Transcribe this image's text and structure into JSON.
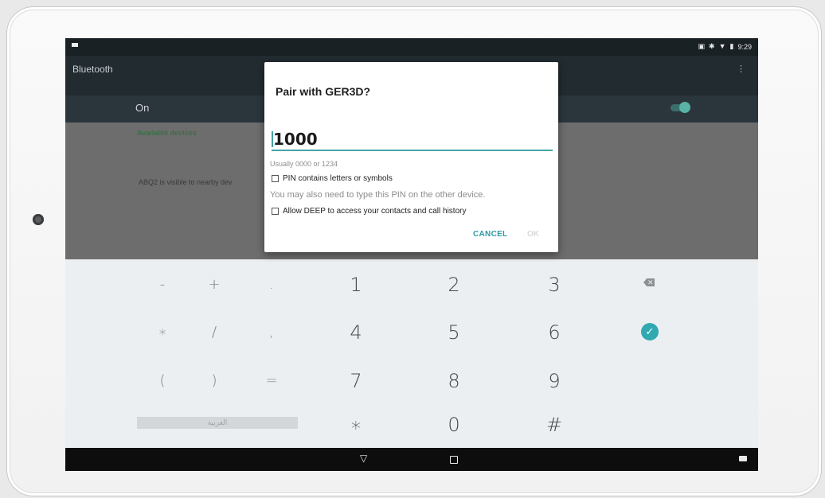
{
  "status": {
    "time": "9:29"
  },
  "app": {
    "title": "Bluetooth",
    "overflow_icon": "more-vert-icon"
  },
  "toggle_row": {
    "label": "On"
  },
  "background_list": {
    "section_header": "Available devices",
    "visible_text": "ABQ2 is visible to nearby dev"
  },
  "dialog": {
    "title": "Pair with GER3D?",
    "pin_value": "1000",
    "pin_hint": "Usually 0000 or 1234",
    "pin_letters_label": "PIN contains letters or symbols",
    "note": "You may also need to type this PIN on the other device.",
    "contacts_label": "Allow DEEP to access your contacts and call history",
    "cancel_label": "CANCEL",
    "ok_label": "OK"
  },
  "keypad": {
    "row1": [
      "-",
      "+",
      ".",
      "1",
      "2",
      "3"
    ],
    "row2": [
      "∗",
      "/",
      ",",
      "4",
      "5",
      "6"
    ],
    "row3": [
      "(",
      ")",
      "=",
      "7",
      "8",
      "9"
    ],
    "row4": [
      "∗",
      "0",
      "#"
    ],
    "language_label": "العربية",
    "done_icon": "check-icon",
    "backspace_icon": "backspace-icon"
  },
  "colors": {
    "accent": "#30a9b1",
    "dialog_accent": "#44a3a6"
  }
}
